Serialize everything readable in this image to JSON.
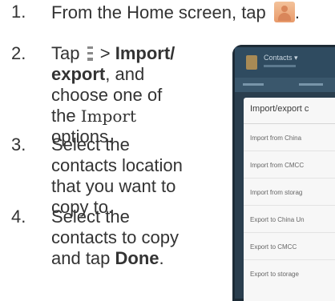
{
  "steps": [
    {
      "number": "1.",
      "text_before": "From the Home screen, tap",
      "icon": "contacts-app-icon",
      "text_after": "."
    },
    {
      "number": "2.",
      "text_tap": "Tap",
      "icon": "menu-icon",
      "separator": ">",
      "bold_text": "Import/ export",
      "text_middle": ", and choose one of the",
      "mono_text": "Import",
      "text_after": "options."
    },
    {
      "number": "3.",
      "text": "Select the contacts location that you want to copy to."
    },
    {
      "number": "4.",
      "text_before": "Select the contacts to copy and tap",
      "bold_text": "Done",
      "text_after": "."
    }
  ],
  "phone": {
    "app_title": "Contacts ▾",
    "dialog_title": "Import/export c",
    "options": [
      "Import from China",
      "Import from CMCC",
      "Import from storag",
      "Export to China Un",
      "Export to CMCC",
      "Export to storage"
    ]
  },
  "colors": {
    "text": "#333333",
    "phone_bg": "#2a3e4e",
    "app_bar": "#2f4b60",
    "dialog_bg": "#f7f7f7",
    "icon_orange": "#e89a6a"
  }
}
